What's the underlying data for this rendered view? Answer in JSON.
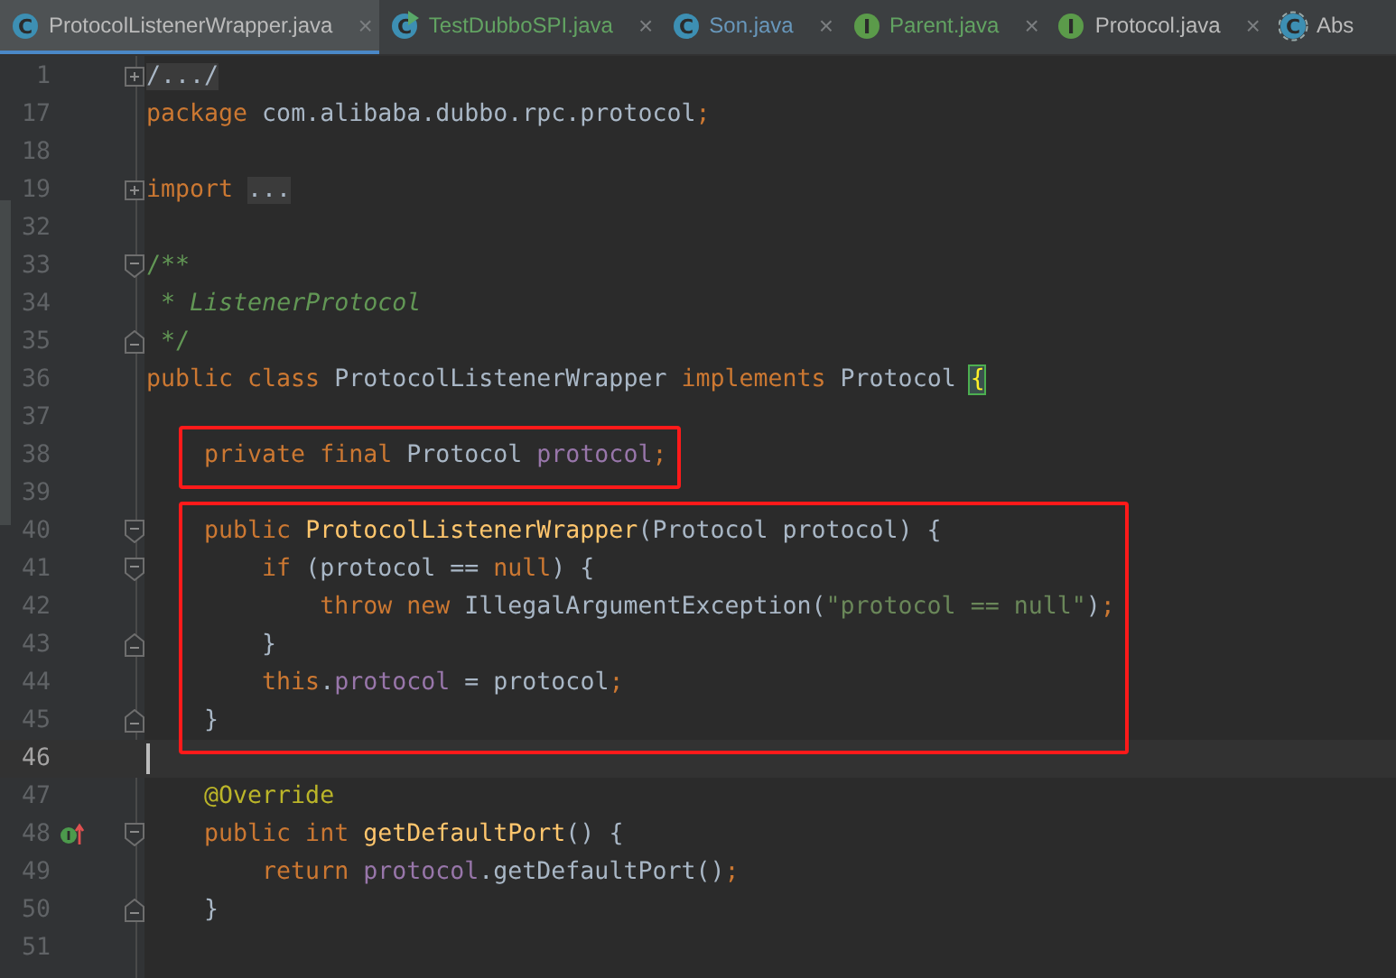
{
  "tabs": [
    {
      "label": "ProtocolListenerWrapper.java",
      "kind": "class",
      "badge": "C",
      "runnable": false,
      "color": "#bbbbbb",
      "selected": true,
      "close": "×"
    },
    {
      "label": "TestDubboSPI.java",
      "kind": "class",
      "badge": "C",
      "runnable": true,
      "color": "#62a362",
      "selected": false,
      "close": "×"
    },
    {
      "label": "Son.java",
      "kind": "class",
      "badge": "C",
      "runnable": false,
      "color": "#6897bb",
      "selected": false,
      "close": "×"
    },
    {
      "label": "Parent.java",
      "kind": "interface",
      "badge": "I",
      "runnable": false,
      "color": "#62a362",
      "selected": false,
      "close": "×"
    },
    {
      "label": "Protocol.java",
      "kind": "interface",
      "badge": "I",
      "runnable": false,
      "color": "#bbbbbb",
      "selected": false,
      "close": "×"
    },
    {
      "label": "Abs",
      "kind": "abstract",
      "badge": "C",
      "runnable": false,
      "color": "#bbbbbb",
      "selected": false
    }
  ],
  "editor": {
    "lines": [
      {
        "number": "1",
        "fold": {
          "kind": "plus"
        },
        "tokens": [
          {
            "t": "/.../",
            "kind": "folded"
          }
        ]
      },
      {
        "number": "17",
        "tokens": [
          {
            "t": "package",
            "kind": "kw"
          },
          {
            "t": " com.alibaba.dubbo.rpc.protocol",
            "kind": "plain"
          },
          {
            "t": ";",
            "kind": "kw"
          }
        ]
      },
      {
        "number": "18"
      },
      {
        "number": "19",
        "fold": {
          "kind": "plus"
        },
        "tokens": [
          {
            "t": "import ",
            "kind": "kw"
          },
          {
            "t": "...",
            "kind": "folded"
          }
        ]
      },
      {
        "number": "32"
      },
      {
        "number": "33",
        "fold": {
          "kind": "start"
        },
        "tokens": [
          {
            "t": "/**",
            "kind": "doc"
          }
        ]
      },
      {
        "number": "34",
        "tokens": [
          {
            "t": " * ",
            "kind": "doc"
          },
          {
            "t": "ListenerProtocol",
            "kind": "doc-italic"
          }
        ]
      },
      {
        "number": "35",
        "fold": {
          "kind": "end"
        },
        "tokens": [
          {
            "t": " */",
            "kind": "doc"
          }
        ]
      },
      {
        "number": "36",
        "tokens": [
          {
            "t": "public class",
            "kind": "kw"
          },
          {
            "t": " ProtocolListenerWrapper ",
            "kind": "plain"
          },
          {
            "t": "implements",
            "kind": "kw"
          },
          {
            "t": " Protocol ",
            "kind": "plain"
          },
          {
            "t": "{",
            "kind": "brace-match"
          }
        ]
      },
      {
        "number": "37"
      },
      {
        "number": "38",
        "boxed": true,
        "tokens": [
          {
            "t": "    private final",
            "kind": "kw"
          },
          {
            "t": " Protocol ",
            "kind": "plain"
          },
          {
            "t": "protocol",
            "kind": "field"
          },
          {
            "t": ";",
            "kind": "kw"
          }
        ]
      },
      {
        "number": "39"
      },
      {
        "number": "40",
        "boxed": true,
        "fold": {
          "kind": "start"
        },
        "tokens": [
          {
            "t": "    public",
            "kind": "kw"
          },
          {
            "t": " ProtocolListenerWrapper",
            "kind": "method"
          },
          {
            "t": "(Protocol protocol) {",
            "kind": "plain"
          }
        ]
      },
      {
        "number": "41",
        "boxed": true,
        "fold": {
          "kind": "start"
        },
        "tokens": [
          {
            "t": "        if",
            "kind": "kw"
          },
          {
            "t": " (protocol == ",
            "kind": "plain"
          },
          {
            "t": "null",
            "kind": "kw"
          },
          {
            "t": ") {",
            "kind": "plain"
          }
        ]
      },
      {
        "number": "42",
        "boxed": true,
        "tokens": [
          {
            "t": "            throw new",
            "kind": "kw"
          },
          {
            "t": " IllegalArgumentException(",
            "kind": "plain"
          },
          {
            "t": "\"protocol == null\"",
            "kind": "string"
          },
          {
            "t": ")",
            "kind": "plain"
          },
          {
            "t": ";",
            "kind": "kw"
          }
        ]
      },
      {
        "number": "43",
        "boxed": true,
        "fold": {
          "kind": "end"
        },
        "tokens": [
          {
            "t": "        }",
            "kind": "plain"
          }
        ]
      },
      {
        "number": "44",
        "boxed": true,
        "tokens": [
          {
            "t": "        this",
            "kind": "kw"
          },
          {
            "t": ".",
            "kind": "plain"
          },
          {
            "t": "protocol",
            "kind": "field"
          },
          {
            "t": " = protocol",
            "kind": "plain"
          },
          {
            "t": ";",
            "kind": "kw"
          }
        ]
      },
      {
        "number": "45",
        "boxed": true,
        "fold": {
          "kind": "end"
        },
        "tokens": [
          {
            "t": "    }",
            "kind": "plain"
          }
        ]
      },
      {
        "number": "46",
        "current": true
      },
      {
        "number": "47",
        "tokens": [
          {
            "t": "    @Override",
            "kind": "annotation"
          }
        ]
      },
      {
        "number": "48",
        "gutter_icon": {
          "kind": "implements"
        },
        "fold": {
          "kind": "start"
        },
        "tokens": [
          {
            "t": "    public int",
            "kind": "kw"
          },
          {
            "t": " getDefaultPort",
            "kind": "method"
          },
          {
            "t": "() {",
            "kind": "plain"
          }
        ]
      },
      {
        "number": "49",
        "tokens": [
          {
            "t": "        return ",
            "kind": "kw"
          },
          {
            "t": "protocol",
            "kind": "field"
          },
          {
            "t": ".getDefaultPort()",
            "kind": "plain"
          },
          {
            "t": ";",
            "kind": "kw"
          }
        ]
      },
      {
        "number": "50",
        "fold": {
          "kind": "end"
        },
        "tokens": [
          {
            "t": "    }",
            "kind": "plain"
          }
        ]
      },
      {
        "number": "51"
      }
    ]
  }
}
